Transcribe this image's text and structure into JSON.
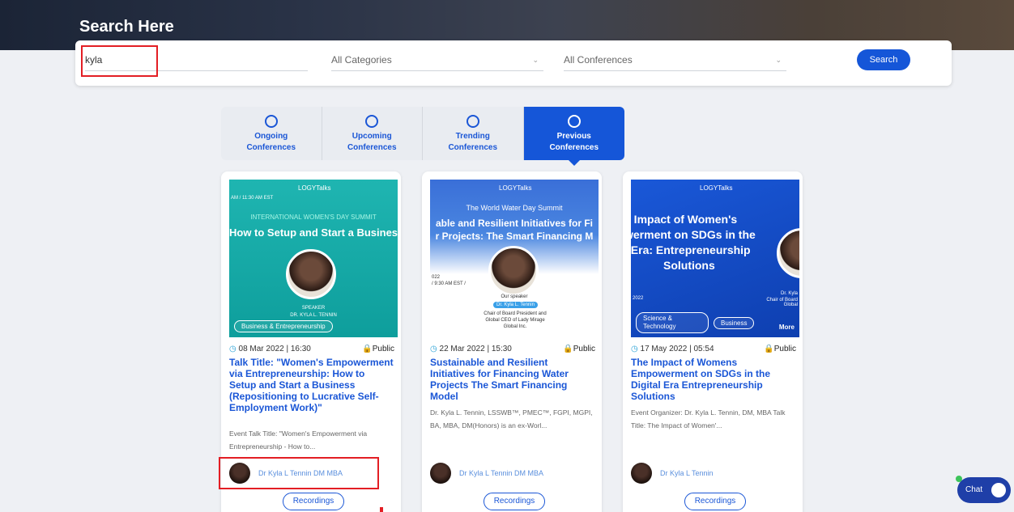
{
  "header": {
    "title": "Search Here"
  },
  "search": {
    "query": "kyla",
    "category": "All Categories",
    "conference": "All Conferences",
    "button": "Search"
  },
  "tabs": [
    {
      "icon": "refresh-icon",
      "label": "Ongoing Conferences"
    },
    {
      "icon": "clock-icon",
      "label": "Upcoming Conferences"
    },
    {
      "icon": "trending-icon",
      "label": "Trending Conferences"
    },
    {
      "icon": "history-icon",
      "label": "Previous Conferences",
      "active": true
    }
  ],
  "cards": [
    {
      "banner_time": "AM / 11:30 AM EST",
      "banner_line1": "INTERNATIONAL WOMEN'S DAY SUMMIT",
      "banner_line2": "How to Setup and Start a Business",
      "banner_speaker_caption": "SPEAKER",
      "banner_speaker": "DR. KYLA L. TENNIN",
      "category": "Business & Entrepreneurship",
      "date": "08 Mar 2022 | 16:30",
      "visibility": "Public",
      "title": "Talk Title: \"Women's Empowerment via Entrepreneurship: How to Setup and Start a Business (Repositioning to Lucrative Self-Employment Work)\"",
      "description": "Event Talk Title: \"Women's Empowerment via Entrepreneurship - How to...",
      "organizer": "Dr Kyla L Tennin DM MBA",
      "recordings": "Recordings"
    },
    {
      "banner_line1": "The World Water Day Summit",
      "banner_line2": "able and Resilient Initiatives for Fi",
      "banner_line3": "r Projects: The Smart Financing M",
      "banner_date": "022",
      "banner_time": "/ 9:30 AM EST /",
      "banner_speaker_caption": "Our speaker",
      "banner_speaker": "Dr. Kyla L. Tennin",
      "banner_role": "Chair of Board President and Global CEO of Lady Mirage Global Inc.",
      "date": "22 Mar 2022 | 15:30",
      "visibility": "Public",
      "title": "Sustainable and Resilient Initiatives for Financing Water Projects The Smart Financing Model",
      "description": "Dr. Kyla L. Tennin, LSSWB™, PMEC™, FGPI, MGPI, BA, MBA, DM(Honors) is an ex-Worl...",
      "organizer": "Dr Kyla L Tennin DM MBA",
      "recordings": "Recordings"
    },
    {
      "banner_line1": "e Impact of Women's",
      "banner_line2": "werment on SDGs in the",
      "banner_line3": "l Era: Entrepreneurship",
      "banner_line4": "Solutions",
      "banner_date": "2022",
      "banner_speaker": "Dr. Kyla",
      "banner_role": "Chair of Board Global",
      "category1": "Science & Technology",
      "category2": "Business",
      "more": "More",
      "date": "17 May 2022 | 05:54",
      "visibility": "Public",
      "title": "The Impact of Womens Empowerment on SDGs in the Digital Era Entrepreneurship Solutions",
      "description": "Event Organizer: Dr. Kyla L. Tennin, DM, MBA Talk Title: The Impact of Women'...",
      "organizer": "Dr Kyla L Tennin",
      "recordings": "Recordings"
    }
  ],
  "chat": {
    "label": "Chat"
  },
  "brand": {
    "logo": "LOGYTalks"
  }
}
